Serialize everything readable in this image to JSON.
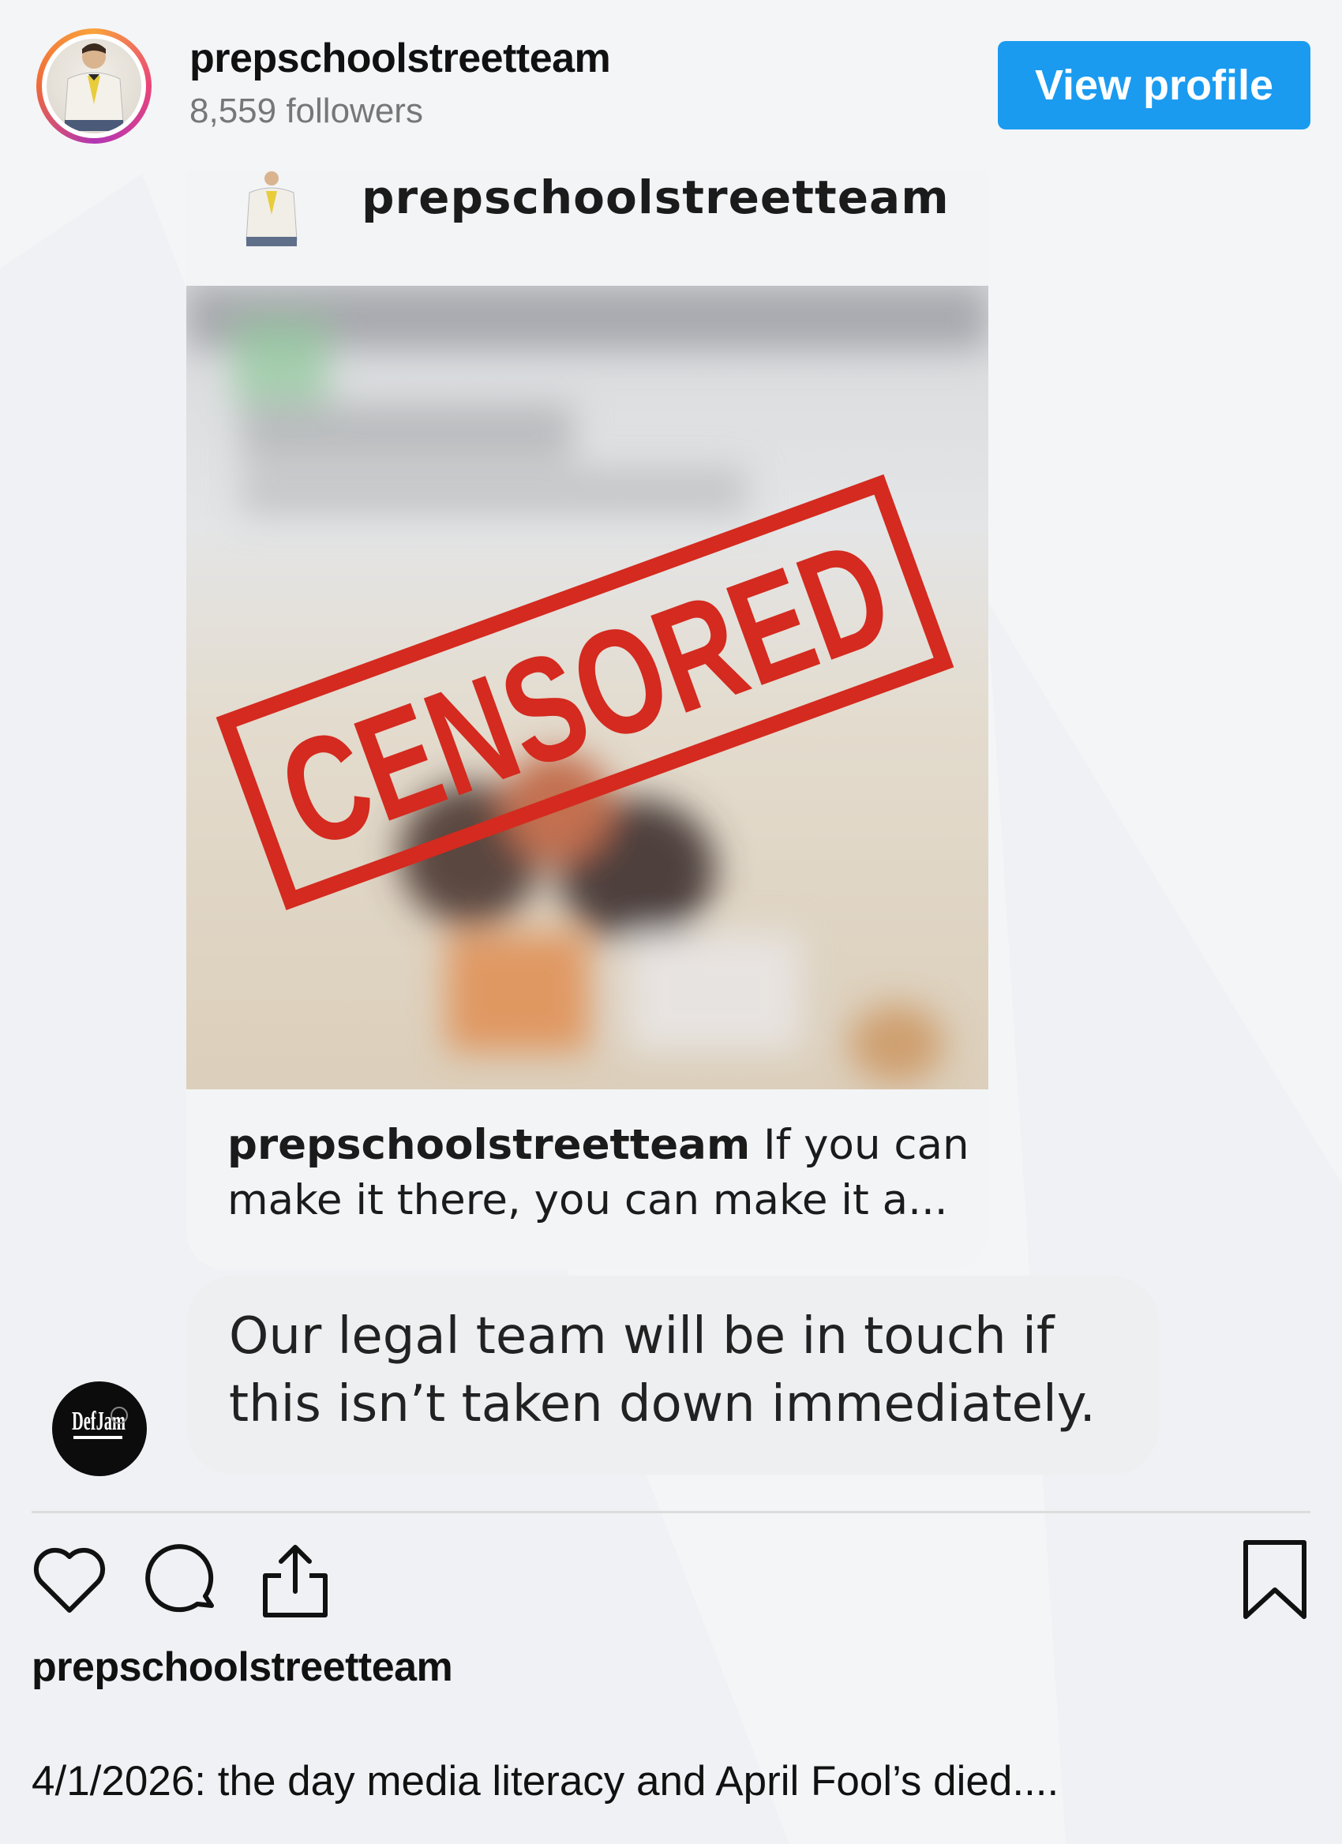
{
  "header": {
    "username": "prepschoolstreetteam",
    "followers": "8,559 followers",
    "view_profile_label": "View profile"
  },
  "embedded_post": {
    "username": "prepschoolstreetteam",
    "stamp_text": "CENSORED",
    "caption_user": "prepschoolstreetteam",
    "caption_text": " If you can make it there, you can make it a..."
  },
  "reply": {
    "avatar_logo_text": "DefJam",
    "message": "Our legal team will be in touch if this isn’t taken down immediately."
  },
  "actions": {
    "like_icon": "heart-icon",
    "comment_icon": "comment-icon",
    "share_icon": "share-icon",
    "save_icon": "bookmark-icon"
  },
  "post": {
    "username": "prepschoolstreetteam",
    "caption": "4/1/2026: the day media literacy and April Fool’s died...."
  },
  "colors": {
    "accent_blue": "#1a9bf0",
    "stamp_red": "#d42a1f",
    "background": "#f4f5f7"
  }
}
